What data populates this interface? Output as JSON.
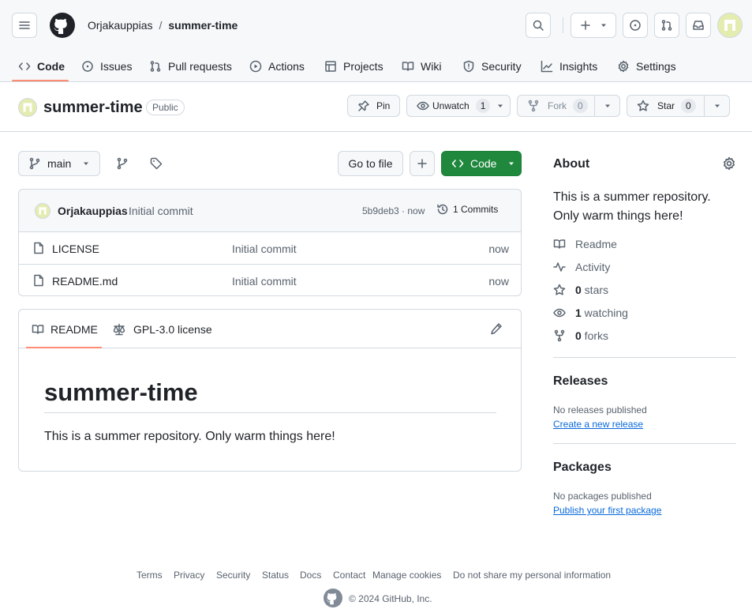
{
  "header": {
    "owner": "Orjakauppias",
    "separator": "/",
    "repo": "summer-time"
  },
  "tabs": [
    {
      "label": "Code",
      "icon": "code-icon"
    },
    {
      "label": "Issues",
      "icon": "issue-icon"
    },
    {
      "label": "Pull requests",
      "icon": "pull-request-icon"
    },
    {
      "label": "Actions",
      "icon": "play-icon"
    },
    {
      "label": "Projects",
      "icon": "table-icon"
    },
    {
      "label": "Wiki",
      "icon": "book-icon"
    },
    {
      "label": "Security",
      "icon": "shield-icon"
    },
    {
      "label": "Insights",
      "icon": "graph-icon"
    },
    {
      "label": "Settings",
      "icon": "gear-icon"
    }
  ],
  "repo_header": {
    "name": "summer-time",
    "visibility": "Public",
    "pin_label": "Pin",
    "unwatch_label": "Unwatch",
    "unwatch_count": "1",
    "fork_label": "Fork",
    "fork_count": "0",
    "star_label": "Star",
    "star_count": "0"
  },
  "toolbar": {
    "branch": "main",
    "go_to_file": "Go to file",
    "code_button": "Code"
  },
  "commit": {
    "author": "Orjakauppias",
    "message": "Initial commit",
    "hash_time": "5b9deb3 · now",
    "commits_label": "1 Commits"
  },
  "files": [
    {
      "name": "LICENSE",
      "message": "Initial commit",
      "time": "now"
    },
    {
      "name": "README.md",
      "message": "Initial commit",
      "time": "now"
    }
  ],
  "readme": {
    "tab_readme": "README",
    "tab_license": "GPL-3.0 license",
    "title": "summer-time",
    "body": "This is a summer repository. Only warm things here!"
  },
  "about": {
    "heading": "About",
    "description": "This is a summer repository. Only warm things here!",
    "readme": "Readme",
    "activity": "Activity",
    "stars_count": "0",
    "stars_label": " stars",
    "watching_count": "1",
    "watching_label": " watching",
    "forks_count": "0",
    "forks_label": " forks"
  },
  "releases": {
    "heading": "Releases",
    "note": "No releases published",
    "link": "Create a new release"
  },
  "packages": {
    "heading": "Packages",
    "note": "No packages published",
    "link": "Publish your first package"
  },
  "footer": {
    "links": [
      "Terms",
      "Privacy",
      "Security",
      "Status",
      "Docs",
      "Contact",
      "Manage cookies",
      "Do not share my personal information"
    ],
    "copyright": "© 2024 GitHub, Inc."
  },
  "colors": {
    "accent_green": "#1f883d",
    "tab_underline": "#fd8c73",
    "link_blue": "#0969da",
    "avatar": "#e4ecb0"
  }
}
